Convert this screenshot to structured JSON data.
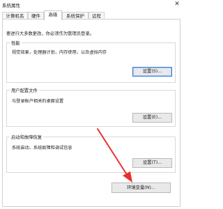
{
  "window": {
    "title": "系统属性",
    "close_glyph": "✕"
  },
  "tabs": [
    {
      "label": "计算机名"
    },
    {
      "label": "硬件"
    },
    {
      "label": "高级",
      "active": true
    },
    {
      "label": "系统保护"
    },
    {
      "label": "远程"
    }
  ],
  "admin_note": "要进行大多数更改，你必须作为管理员登录。",
  "performance": {
    "title": "性能",
    "description": "视觉效果，处理器计划，内存使用，以及虚拟内存",
    "button": "设置(S)..."
  },
  "user_profiles": {
    "title": "用户配置文件",
    "description": "与登录帐户相关的桌面设置",
    "button": "设置(E)..."
  },
  "startup_recovery": {
    "title": "启动和故障恢复",
    "description": "系统启动、系统故障和调试信息",
    "button": "设置(T)..."
  },
  "env_button": "环境变量(N)...",
  "colors": {
    "annotation_arrow": "#e8312a",
    "focus_border": "#3d7fd8"
  }
}
